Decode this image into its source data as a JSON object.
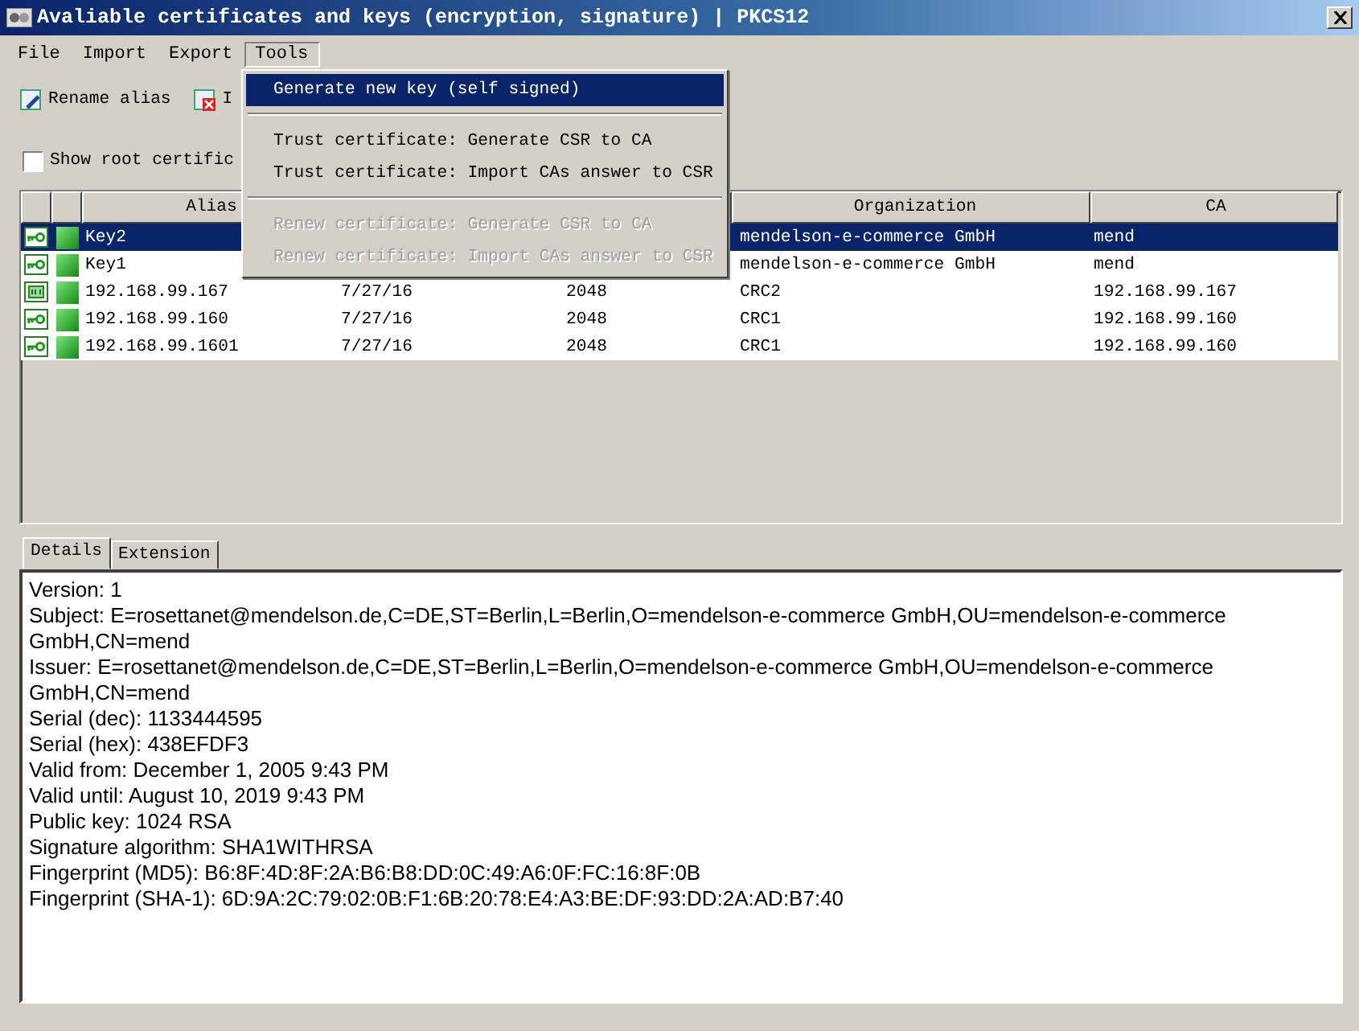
{
  "window": {
    "title": "Avaliable certificates and keys (encryption, signature) | PKCS12"
  },
  "menu_bar": [
    {
      "label": "File",
      "selected": false
    },
    {
      "label": "Import",
      "selected": false
    },
    {
      "label": "Export",
      "selected": false
    },
    {
      "label": "Tools",
      "selected": true
    }
  ],
  "tools_menu": [
    {
      "kind": "item",
      "label": "Generate new key (self signed)",
      "selected": true,
      "disabled": false
    },
    {
      "kind": "separator"
    },
    {
      "kind": "item",
      "label": "Trust certificate: Generate CSR to CA",
      "selected": false,
      "disabled": false
    },
    {
      "kind": "item",
      "label": "Trust certificate: Import CAs answer to CSR",
      "selected": false,
      "disabled": false
    },
    {
      "kind": "separator"
    },
    {
      "kind": "item",
      "label": "Renew certificate: Generate CSR to CA",
      "selected": false,
      "disabled": true
    },
    {
      "kind": "item",
      "label": "Renew certificate: Import CAs answer to CSR",
      "selected": false,
      "disabled": true
    }
  ],
  "toolbar": [
    {
      "kind": "rename",
      "label": "Rename alias"
    },
    {
      "kind": "delete",
      "label": "I"
    }
  ],
  "show_root_checkbox": {
    "label": "Show root certific",
    "checked": false
  },
  "table": {
    "alias_header": "Alias",
    "organization_header": "Organization",
    "ca_header": "CA",
    "rows": [
      {
        "kind": "key",
        "selected": true,
        "alias": "Key2",
        "organization": "mendelson-e-commerce GmbH",
        "ca": "mend"
      },
      {
        "kind": "key",
        "selected": false,
        "alias": "Key1",
        "organization": "mendelson-e-commerce GmbH",
        "ca": "mend"
      },
      {
        "kind": "certificate",
        "selected": false,
        "alias": "192.168.99.167",
        "column_4": "7/27/16",
        "column_5": "2048",
        "organization": "CRC2",
        "ca": "192.168.99.167"
      },
      {
        "kind": "key",
        "selected": false,
        "alias": "192.168.99.160",
        "column_4": "7/27/16",
        "column_5": "2048",
        "organization": "CRC1",
        "ca": "192.168.99.160"
      },
      {
        "kind": "key",
        "selected": false,
        "alias": "192.168.99.1601",
        "column_4": "7/27/16",
        "column_5": "2048",
        "organization": "CRC1",
        "ca": "192.168.99.160"
      }
    ]
  },
  "detail_tabs": [
    {
      "label": "Details",
      "selected": true
    },
    {
      "label": "Extension",
      "selected": false
    }
  ],
  "details": [
    "Version: 1",
    "Subject: E=rosettanet@mendelson.de,C=DE,ST=Berlin,L=Berlin,O=mendelson-e-commerce GmbH,OU=mendelson-e-commerce GmbH,CN=mend",
    "Issuer: E=rosettanet@mendelson.de,C=DE,ST=Berlin,L=Berlin,O=mendelson-e-commerce GmbH,OU=mendelson-e-commerce GmbH,CN=mend",
    "Serial (dec): 1133444595",
    "Serial (hex): 438EFDF3",
    "Valid from: December 1, 2005 9:43 PM",
    "Valid until: August 10, 2019 9:43 PM",
    "Public key: 1024 RSA",
    "Signature algorithm: SHA1WITHRSA",
    "Fingerprint (MD5): B6:8F:4D:8F:2A:B6:B8:DD:0C:49:A6:0F:FC:16:8F:0B",
    "Fingerprint (SHA-1): 6D:9A:2C:79:02:0B:F1:6B:20:78:E4:A3:BE:DF:93:DD:2A:AD:B7:40"
  ]
}
